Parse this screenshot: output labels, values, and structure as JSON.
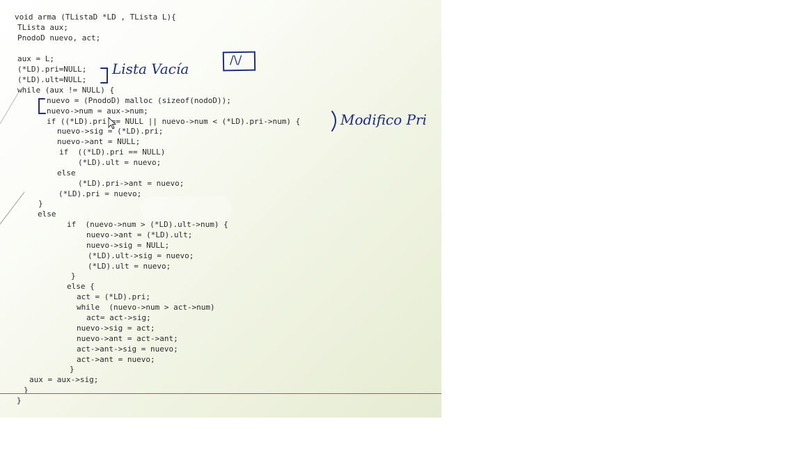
{
  "code": {
    "l1": "void arma (TListaD *LD , TLista L){",
    "l2": "TLista aux;",
    "l3": "PnodoD nuevo, act;",
    "l4": "aux = L;",
    "l5": "(*LD).pri=NULL;",
    "l6": "(*LD).ult=NULL;",
    "l7": "while (aux != NULL) {",
    "l8": "nuevo = (PnodoD) malloc (sizeof(nodoD));",
    "l9": "nuevo->num = aux->num;",
    "l10": "if ((*LD).pri == NULL || nuevo->num < (*LD).pri->num) {",
    "l11": "nuevo->sig = (*LD).pri;",
    "l12": "nuevo->ant = NULL;",
    "l13": "if  ((*LD).pri == NULL)",
    "l14": "(*LD).ult = nuevo;",
    "l15": "else",
    "l16": "(*LD).pri->ant = nuevo;",
    "l17": "(*LD).pri = nuevo;",
    "l18": "}",
    "l19": "else",
    "l20": "if  (nuevo->num > (*LD).ult->num) {",
    "l21": "nuevo->ant = (*LD).ult;",
    "l22": "nuevo->sig = NULL;",
    "l23": "(*LD).ult->sig = nuevo;",
    "l24": "(*LD).ult = nuevo;",
    "l25": "}",
    "l26": "else {",
    "l27": "act = (*LD).pri;",
    "l28": "while  (nuevo->num > act->num)",
    "l29": "act= act->sig;",
    "l30": "nuevo->sig = act;",
    "l31": "nuevo->ant = act->ant;",
    "l32": "act->ant->sig = nuevo;",
    "l33": "act->ant = nuevo;",
    "l34": "}",
    "l35": "aux = aux->sig;",
    "l36": "}",
    "l37": "}"
  },
  "annotations": {
    "lista_vacia": "Lista Vacía",
    "modifico_pri": "Modifico Pri",
    "null_box": "/\\/"
  },
  "colors": {
    "ink": "#1c2f7a",
    "code_text": "#2a2a2a",
    "rule": "#b65a3b"
  },
  "icons": {
    "cursor": "arrow-pointer-icon"
  }
}
